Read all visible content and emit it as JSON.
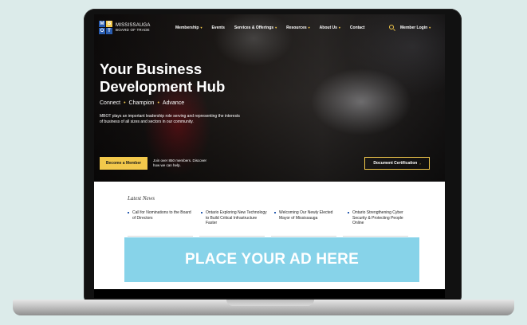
{
  "colors": {
    "accent_yellow": "#f2c84b",
    "ad_background": "#87d3e9",
    "page_background": "#dcebea",
    "logo_tiles": [
      "#2a5db0",
      "#f2c84b",
      "#2a5db0",
      "#2a5db0"
    ]
  },
  "header": {
    "logo_letters": [
      "M",
      "B",
      "O",
      "T"
    ],
    "logo_line1": "MISSISSAUGA",
    "logo_line2": "BOARD OF TRADE",
    "nav_items": [
      {
        "label": "Membership",
        "has_dropdown": true
      },
      {
        "label": "Events",
        "has_dropdown": false
      },
      {
        "label": "Services & Offerings",
        "has_dropdown": true
      },
      {
        "label": "Resources",
        "has_dropdown": true
      },
      {
        "label": "About Us",
        "has_dropdown": true
      },
      {
        "label": "Contact",
        "has_dropdown": false
      }
    ],
    "search_icon": "search-icon",
    "login_label": "Member Login",
    "login_caret": "▾"
  },
  "hero": {
    "title": "Your Business Development Hub",
    "tagline": [
      "Connect",
      "Champion",
      "Advance"
    ],
    "description": "MBOT plays an important leadership role serving and representing the interests of business of all sizes and sectors in our community.",
    "primary_button": "Become a Member",
    "join_text": "Join over 850 members. Discover how we can help.",
    "secondary_button": "Document Certification",
    "secondary_caret": "›"
  },
  "news": {
    "heading": "Latest News",
    "items": [
      "Call for Nominations to the Board of Directors",
      "Ontario Exploring New Technology to Build Critical Infrastructure Faster",
      "Welcoming Our Newly Elected Mayor of Mississauga",
      "Ontario Strengthening Cyber Security & Protecting People Online"
    ]
  },
  "ad": {
    "text": "PLACE YOUR AD HERE"
  }
}
